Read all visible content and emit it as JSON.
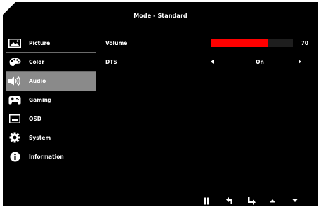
{
  "header": {
    "title": "Mode - Standard"
  },
  "menu": {
    "items": [
      {
        "label": "Picture",
        "icon": "picture-icon",
        "active": false
      },
      {
        "label": "Color",
        "icon": "palette-icon",
        "active": false
      },
      {
        "label": "Audio",
        "icon": "speaker-icon",
        "active": true
      },
      {
        "label": "Gaming",
        "icon": "gamepad-icon",
        "active": false
      },
      {
        "label": "OSD",
        "icon": "osd-window-icon",
        "active": false
      },
      {
        "label": "System",
        "icon": "gear-icon",
        "active": false
      },
      {
        "label": "Information",
        "icon": "info-icon",
        "active": false
      }
    ]
  },
  "settings": {
    "volume": {
      "label": "Volume",
      "value": "70",
      "level": 0.7
    },
    "dts": {
      "label": "DTS",
      "value": "On"
    }
  },
  "controls": [
    "pause-icon",
    "back-icon",
    "enter-icon",
    "up-icon",
    "down-icon"
  ],
  "colors": {
    "background": "#000000",
    "accent": "#ff0000",
    "active_item": "#8a8a8a"
  }
}
